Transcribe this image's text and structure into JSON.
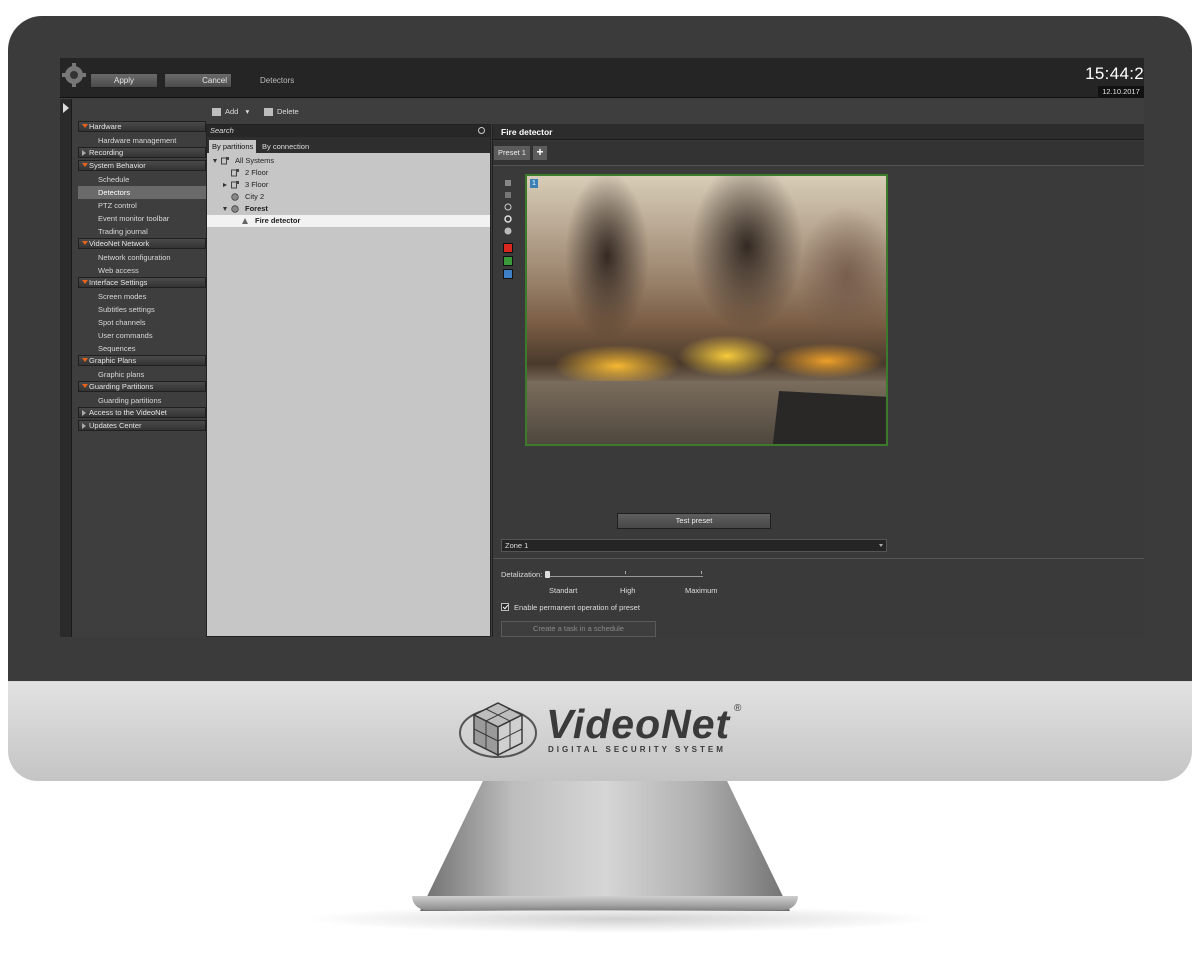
{
  "app": {
    "module_title": "Detectors",
    "apply_label": "Apply",
    "cancel_label": "Cancel",
    "clock": "15:44:2",
    "date": "12.10.2017"
  },
  "nav": {
    "sections": [
      {
        "label": "Hardware",
        "items": [
          "Hardware management"
        ]
      },
      {
        "label": "Recording",
        "items": []
      },
      {
        "label": "System Behavior",
        "items": [
          "Schedule",
          "Detectors",
          "PTZ control",
          "Event monitor toolbar",
          "Trading journal"
        ]
      },
      {
        "label": "VideoNet Network",
        "items": [
          "Network configuration",
          "Web access"
        ]
      },
      {
        "label": "Interface Settings",
        "items": [
          "Screen modes",
          "Subtitles settings",
          "Spot channels",
          "User commands",
          "Sequences"
        ]
      },
      {
        "label": "Graphic Plans",
        "items": [
          "Graphic plans"
        ]
      },
      {
        "label": "Guarding Partitions",
        "items": [
          "Guarding partitions"
        ]
      },
      {
        "label": "Access to the VideoNet",
        "items": []
      },
      {
        "label": "Updates Center",
        "items": []
      }
    ],
    "selected": "Detectors"
  },
  "toolbar": {
    "add_label": "Add",
    "delete_label": "Delete"
  },
  "tree": {
    "search_placeholder": "Search",
    "tab_partitions": "By partitions",
    "tab_connection": "By connection",
    "nodes": [
      "All Systems",
      "2 Floor",
      "3 Floor",
      "City 2",
      "Forest",
      "Fire detector"
    ]
  },
  "detector": {
    "title": "Fire detector",
    "preset_tab": "Preset 1",
    "preset_add": "+",
    "video_badge": "1",
    "test_preset_label": "Test preset",
    "zone_value": "Zone 1",
    "detalization_label": "Detalization:",
    "detalization_levels": [
      "Standart",
      "High",
      "Maximum"
    ],
    "detalization_value": "Standart",
    "enable_permanent_label": "Enable permanent operation of preset",
    "enable_permanent_checked": true,
    "create_task_label": "Create a task in a schedule"
  },
  "brand": {
    "name": "VideoNet",
    "registered": "®",
    "tagline": "DIGITAL SECURITY SYSTEM"
  },
  "colors": {
    "nav_section_arrow": "#e8621b",
    "video_border": "#3d7a2c",
    "zone_red": "#d9281e",
    "zone_green": "#3a9a3a",
    "zone_blue": "#3f7fc6"
  }
}
